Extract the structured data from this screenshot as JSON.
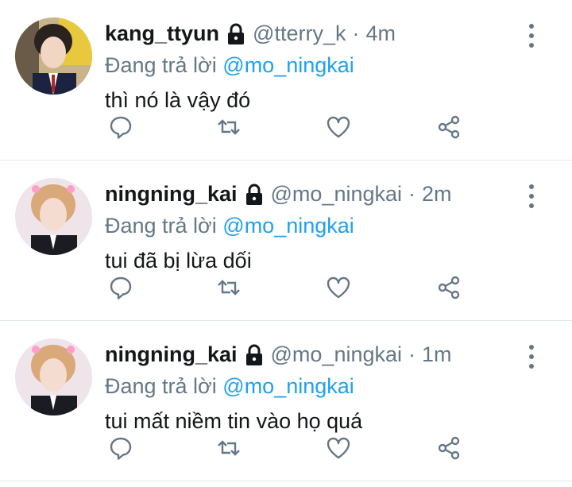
{
  "reply_prefix": "Đang trả lời",
  "tweets": [
    {
      "display_name": "kang_ttyun",
      "handle": "@tterry_k",
      "separator": "·",
      "time": "4m",
      "reply_to": "@mo_ningkai",
      "text": "thì nó là vậy đó",
      "avatar": "avatar-kang-ttyun"
    },
    {
      "display_name": "ningning_kai",
      "handle": "@mo_ningkai",
      "separator": "·",
      "time": "2m",
      "reply_to": "@mo_ningkai",
      "text": "tui đã bị lừa dối",
      "avatar": "avatar-ningning-kai"
    },
    {
      "display_name": "ningning_kai",
      "handle": "@mo_ningkai",
      "separator": "·",
      "time": "1m",
      "reply_to": "@mo_ningkai",
      "text": "tui mất niềm tin vào họ quá",
      "avatar": "avatar-ningning-kai"
    }
  ],
  "colors": {
    "text_primary": "#14171a",
    "text_secondary": "#657786",
    "mention": "#1da1f2",
    "divider": "#e1e8ed"
  },
  "icons": [
    "lock-icon",
    "reply-icon",
    "retweet-icon",
    "like-icon",
    "share-icon",
    "more-options-icon"
  ]
}
